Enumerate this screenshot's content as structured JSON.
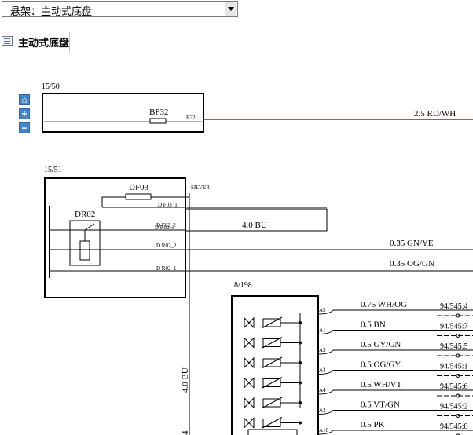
{
  "selector": {
    "value": "悬架：主动式底盘"
  },
  "header": {
    "title": "主动式底盘"
  },
  "zoom": {
    "home": "⌂",
    "in": "+",
    "out": "−"
  },
  "diagram": {
    "block1": {
      "ref": "15/50",
      "fuse": "BF32",
      "pin": "B32",
      "wire": "2.5 RD/WH"
    },
    "block2": {
      "ref": "15/51",
      "fuse": "DF03",
      "relay": "DR02",
      "shield": "SILVER",
      "pin_f03": "D F03_1",
      "pin_r02_3": "D R02_3",
      "pin_f03_2": "D F03_2",
      "pin_r02_2": "D R02_2",
      "pin_r02_1": "D R02_1",
      "wire_bu": "4.0 BU",
      "wire_gnye": "0.35 GN/YE",
      "wire_oggn": "0.35 OG/GN"
    },
    "vertical_wire": "4.0 BU",
    "vertical_wire_tail": "4",
    "block3": {
      "ref": "8/198",
      "rows": [
        {
          "pin": "A5",
          "wire": "0.75 WH/OG",
          "conn": "94/545:4"
        },
        {
          "pin": "A1",
          "wire": "0.5 BN",
          "conn": "94/545:7"
        },
        {
          "pin": "A3",
          "wire": "0.5 GY/GN",
          "conn": "94/545:5"
        },
        {
          "pin": "A3",
          "wire": "0.5 OG/GY",
          "conn": "94/545:1"
        },
        {
          "pin": "A4",
          "wire": "0.5 WH/VT",
          "conn": "94/545:6"
        },
        {
          "pin": "A2",
          "wire": "0.5 VT/GN",
          "conn": "94/545:2"
        },
        {
          "pin": "A10",
          "wire": "0.5 PK",
          "conn": "94/545:8"
        }
      ]
    },
    "colors": {
      "power_wire": "#d40000",
      "button": "#3e86c8"
    }
  }
}
